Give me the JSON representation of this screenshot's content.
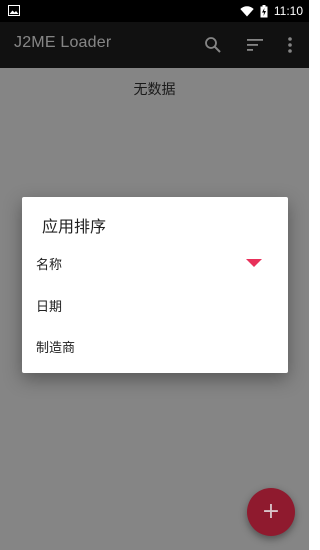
{
  "statusbar": {
    "time": "11:10",
    "icons": [
      "image-icon",
      "wifi-icon",
      "battery-charging-icon"
    ]
  },
  "appbar": {
    "title": "J2ME Loader",
    "icons": [
      "search-icon",
      "sort-icon",
      "more-vert-icon"
    ]
  },
  "content": {
    "empty_text": "无数据"
  },
  "dialog": {
    "title": "应用排序",
    "items": [
      {
        "label": "名称",
        "selected": true
      },
      {
        "label": "日期",
        "selected": false
      },
      {
        "label": "制造商",
        "selected": false
      }
    ],
    "accent_color": "#e8305a"
  },
  "fab": {
    "icon": "plus-icon",
    "color": "#8f1a2e"
  }
}
